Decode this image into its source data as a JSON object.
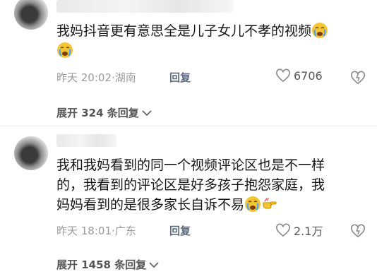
{
  "comments": [
    {
      "lines": [
        "我妈抖音更有意思全是儿子女儿不孝的视频"
      ],
      "emoji_after": [
        "crying-face-emoji",
        "crying-face-emoji"
      ],
      "time": "昨天 20:02",
      "location": "湖南",
      "reply_label": "回复",
      "likes": "6706",
      "expand_label": "展开 324 条回复"
    },
    {
      "lines": [
        "我和我妈看到的同一个视频评论区也是不一样",
        "的，我看到的评论区是好多孩子抱怨家庭，我",
        "妈妈看到的是很多家长自诉不易"
      ],
      "emoji_after": [
        "crying-face-emoji",
        "pointing-hand-emoji"
      ],
      "time": "昨天 18:01",
      "location": "广东",
      "reply_label": "回复",
      "likes": "2.1万",
      "expand_label": "展开 1458 条回复"
    }
  ],
  "colors": {
    "meta": "#9a9a9a",
    "reply": "#5f6b80",
    "emoji": "#f6c534"
  }
}
